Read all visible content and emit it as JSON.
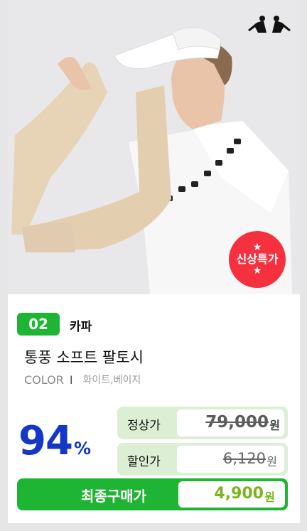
{
  "product": {
    "rank": "02",
    "brand": "카파",
    "title": "통풍 소프트 팔토시",
    "color_label": "COLOR",
    "color_separator": "I",
    "colors": "화이트,베이지",
    "badge_line": "신상특가",
    "badge_star": "★"
  },
  "pricing": {
    "discount_value": "94",
    "discount_unit": "%",
    "regular_label": "정상가",
    "regular_price": "79,000",
    "regular_unit": "원",
    "sale_label": "할인가",
    "sale_price": "6,120",
    "sale_unit": "원",
    "final_label": "최종구매가",
    "final_price": "4,900",
    "final_unit": "원"
  },
  "colors": {
    "accent_green": "#1fb534",
    "price_bg": "#dcefd5",
    "discount_blue": "#1537c7",
    "badge_red": "#f5303f",
    "final_price_green": "#7ab51d"
  },
  "icons": {
    "brand_logo": "kappa-logo-icon"
  }
}
